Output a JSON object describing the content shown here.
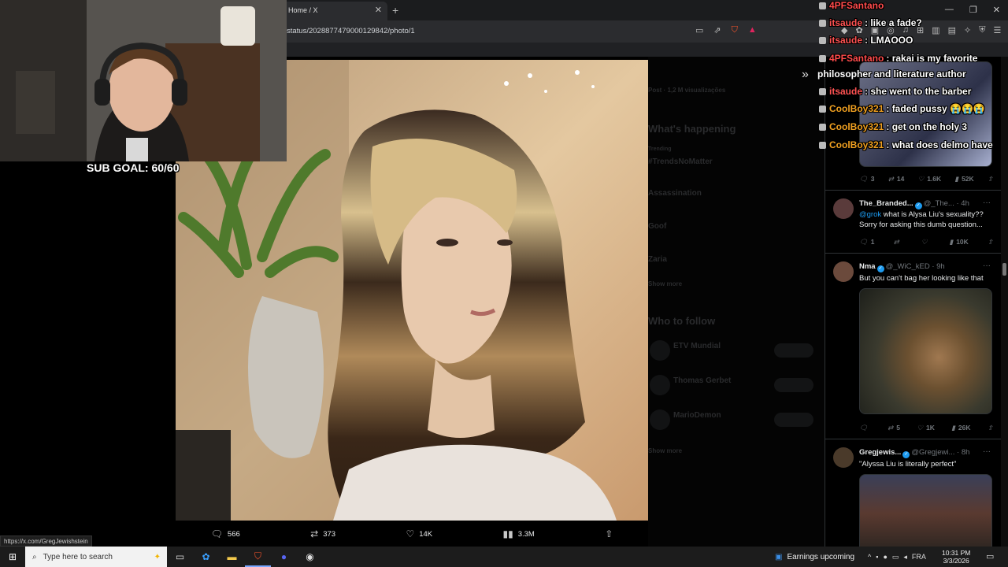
{
  "browser": {
    "tab_title": "Home / X",
    "url": "status/2028877479000129842/photo/1",
    "status_url": "https://x.com/GregJewishstein"
  },
  "overlay": {
    "sub_goal": "SUB GOAL: 60/60"
  },
  "chat": [
    {
      "user": "4PFSantano",
      "text": "",
      "color": "#ff4b4b"
    },
    {
      "user": "itsaude",
      "text": ": like a fade?",
      "color": "#ff5252"
    },
    {
      "user": "itsaude",
      "text": ": LMAOOO",
      "color": "#ff5252"
    },
    {
      "user": "4PFSantano",
      "text": ": rakai is my favorite",
      "color": "#ff4b4b"
    },
    {
      "user": "",
      "text": "philosopher and literature author",
      "color": "#ffffff"
    },
    {
      "user": "itsaude",
      "text": ": she went to the barber",
      "color": "#ff5252"
    },
    {
      "user": "CoolBoy321",
      "text": ": faded pussy 😭😭😭",
      "color": "#f0a020"
    },
    {
      "user": "CoolBoy321",
      "text": ": get on the holy 3",
      "color": "#f0a020"
    },
    {
      "user": "CoolBoy321",
      "text": ": what does delmo have",
      "color": "#f0a020"
    }
  ],
  "photo_actions": {
    "replies": "566",
    "reposts": "373",
    "likes": "14K",
    "views": "3.3M"
  },
  "feed": {
    "post1": {
      "replies": "3",
      "reposts": "14",
      "likes": "1.6K",
      "views": "52K"
    },
    "post2": {
      "name": "The_Branded...",
      "handle": "@_The...",
      "time": "· 4h",
      "mention": "@grok",
      "text": " what is Alysa Liu's sexuality?? Sorry for asking this dumb question...",
      "replies": "1",
      "reposts": "",
      "likes": "",
      "views": "10K"
    },
    "post3": {
      "name": "Nma",
      "handle": "@_WiC_kED",
      "time": "· 9h",
      "text": "But you can't bag her looking like that",
      "replies": "",
      "reposts": "5",
      "likes": "1K",
      "views": "26K"
    },
    "post4": {
      "name": "Gregjewis...",
      "handle": "@Gregjewi...",
      "time": "· 8h",
      "text": "\"Alyssa Liu is literally perfect\""
    }
  },
  "taskbar": {
    "search_placeholder": "Type here to search",
    "weather_text": "Earnings upcoming",
    "lang": "FRA",
    "time": "10:31 PM",
    "date": "3/3/2026"
  },
  "colors": {
    "accent": "#1d9bf0",
    "background": "#000000"
  }
}
